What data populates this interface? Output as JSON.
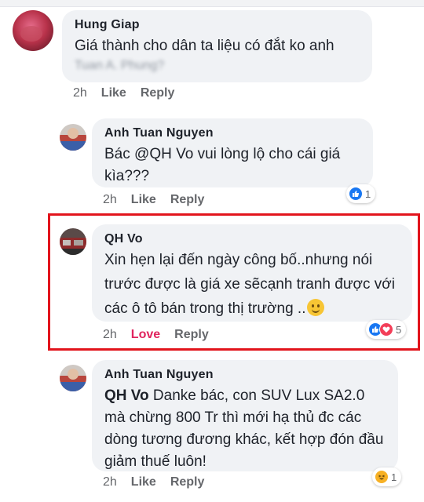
{
  "comments": [
    {
      "author": "Hung Giap",
      "text": "Giá thành cho dân ta liệu có đắt ko anh",
      "blurred_text": "Tuan A. Phung?",
      "time": "2h",
      "like_label": "Like",
      "reply_label": "Reply"
    },
    {
      "author": "Anh Tuan Nguyen",
      "text_prefix": "Bác ",
      "mention": "@QH Vo",
      "text_rest": " vui lòng lộ cho cái giá kìa???",
      "time": "2h",
      "like_label": "Like",
      "reply_label": "Reply",
      "reaction_count": "1"
    },
    {
      "author": "QH Vo",
      "text": "Xin hẹn lại đến ngày công bố..nhưng nói trước được là giá xe sẽcạnh tranh được với các ô tô bán trong thị trường ..",
      "time": "2h",
      "love_label": "Love",
      "reply_label": "Reply",
      "reaction_count": "5"
    },
    {
      "author": "Anh Tuan Nguyen",
      "mention": "QH Vo",
      "text_rest": " Danke bác, con SUV Lux SA2.0 mà chừng 800 Tr thì mới hạ thủ đc các dòng tương đương khác, kết hợp đón đầu giảm thuế luôn!",
      "time": "2h",
      "like_label": "Like",
      "reply_label": "Reply",
      "reaction_count": "1"
    }
  ],
  "colors": {
    "highlight_border": "#e2141c",
    "bubble_bg": "#f0f2f5",
    "love": "#e0245e",
    "like_blue": "#1877f2"
  },
  "icons": {
    "like_reaction": "thumbs-up-icon",
    "love_reaction": "heart-icon",
    "haha_reaction": "laughing-face-icon",
    "smiley": "smiley-emoji-icon"
  }
}
